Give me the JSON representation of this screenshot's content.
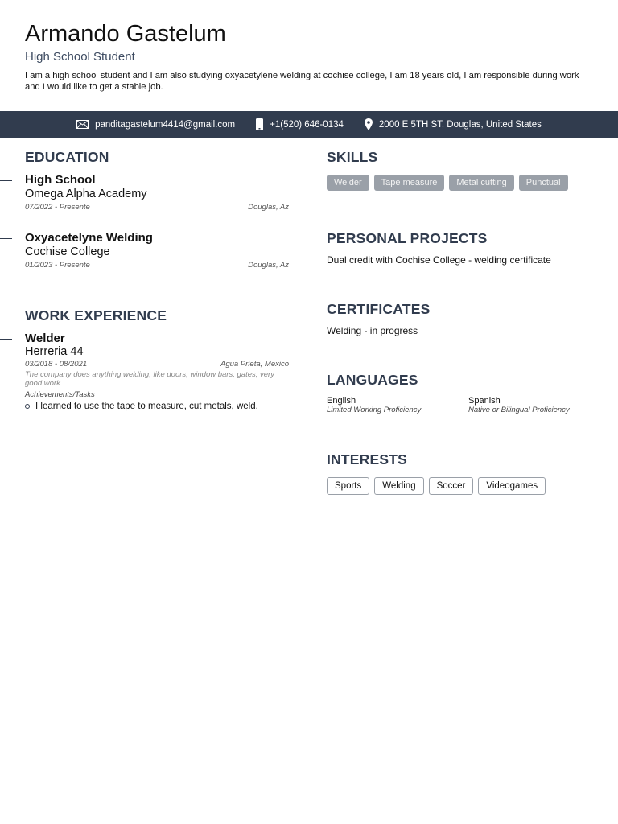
{
  "header": {
    "name": "Armando Gastelum",
    "role": "High School Student",
    "summary": "I am a high school student and I am also studying oxyacetylene welding at cochise college, I am 18 years old, I am responsible during work and I would like to get a stable job."
  },
  "contact": {
    "email": "panditagastelum4414@gmail.com",
    "phone": "+1(520) 646-0134",
    "address": "2000 E 5TH ST, Douglas, United States"
  },
  "education": {
    "heading": "EDUCATION",
    "items": [
      {
        "title": "High School",
        "org": "Omega Alpha Academy",
        "dates": "07/2022 - Presente",
        "location": "Douglas, Az"
      },
      {
        "title": "Oxyacetelyne Welding",
        "org": "Cochise College",
        "dates": "01/2023 - Presente",
        "location": "Douglas, Az"
      }
    ]
  },
  "work": {
    "heading": "WORK EXPERIENCE",
    "items": [
      {
        "title": "Welder",
        "org": "Herreria 44",
        "dates": "03/2018 - 08/2021",
        "location": "Agua Prieta, Mexico",
        "description": "The company does anything welding, like doors, window bars, gates, very good work.",
        "tasks_label": "Achievements/Tasks",
        "tasks": [
          "I learned to use the tape to measure, cut metals, weld."
        ]
      }
    ]
  },
  "skills": {
    "heading": "SKILLS",
    "items": [
      "Welder",
      "Tape measure",
      "Metal cutting",
      "Punctual"
    ]
  },
  "projects": {
    "heading": "PERSONAL PROJECTS",
    "items": [
      "Dual credit with Cochise College - welding certificate"
    ]
  },
  "certificates": {
    "heading": "CERTIFICATES",
    "items": [
      "Welding - in progress"
    ]
  },
  "languages": {
    "heading": "LANGUAGES",
    "items": [
      {
        "name": "English",
        "level": "Limited Working Proficiency"
      },
      {
        "name": "Spanish",
        "level": "Native or Bilingual Proficiency"
      }
    ]
  },
  "interests": {
    "heading": "INTERESTS",
    "items": [
      "Sports",
      "Welding",
      "Soccer",
      "Videogames"
    ]
  },
  "colors": {
    "accent": "#313c4e",
    "tag": "#9aa0a8"
  }
}
